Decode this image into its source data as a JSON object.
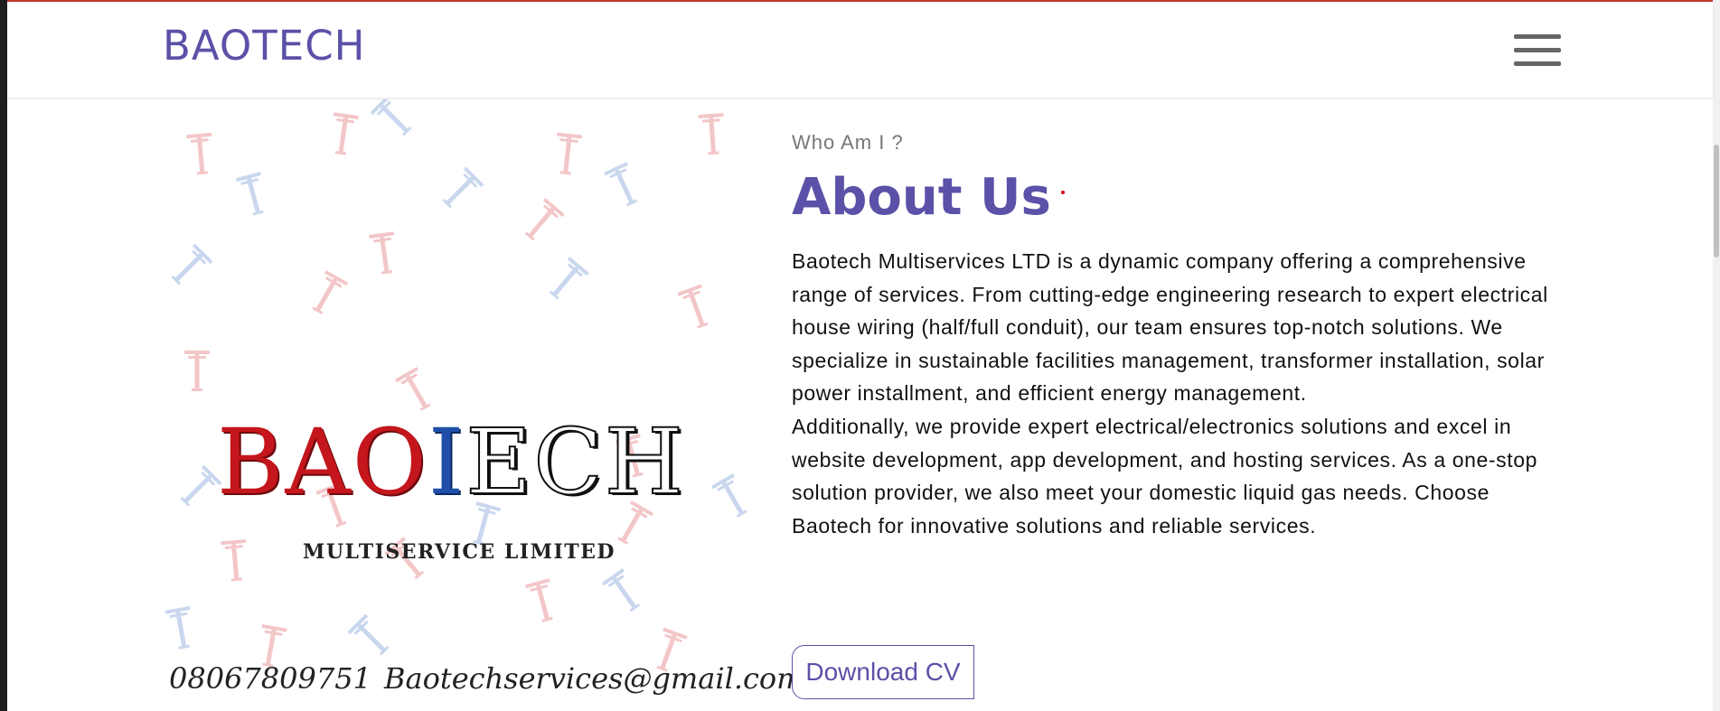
{
  "navbar": {
    "brand": "BAOTECH",
    "menu_icon": "hamburger-menu-icon"
  },
  "hero_logo": {
    "letters_red": "BAO",
    "letter_blue": "I",
    "letters_black": "ECH",
    "subtitle": "MULTISERVICE LIMITED",
    "phone": "08067809751",
    "email": "Baotechservices@gmail.com",
    "pattern_icon": "utility-pole-icon"
  },
  "about": {
    "eyebrow": "Who Am I ?",
    "heading": "About Us",
    "paragraph_1": "Baotech Multiservices LTD is a dynamic company offering a comprehensive range of services. From cutting-edge engineering research to expert electrical house wiring (half/full conduit), our team ensures top-notch solutions. We specialize in sustainable facilities management, transformer installation, solar power installment, and efficient energy management.",
    "paragraph_2": "Additionally, we provide expert electrical/electronics solutions and excel in website development, app development, and hosting services. As a one-stop solution provider, we also meet your domestic liquid gas needs. Choose Baotech for innovative solutions and reliable services.",
    "cv_button": "Download CV"
  },
  "colors": {
    "brand_purple": "#5b51a8",
    "logo_red": "#c4161c",
    "logo_blue": "#1f4fa8",
    "text_dark": "#111111",
    "eyebrow_gray": "#777777"
  }
}
